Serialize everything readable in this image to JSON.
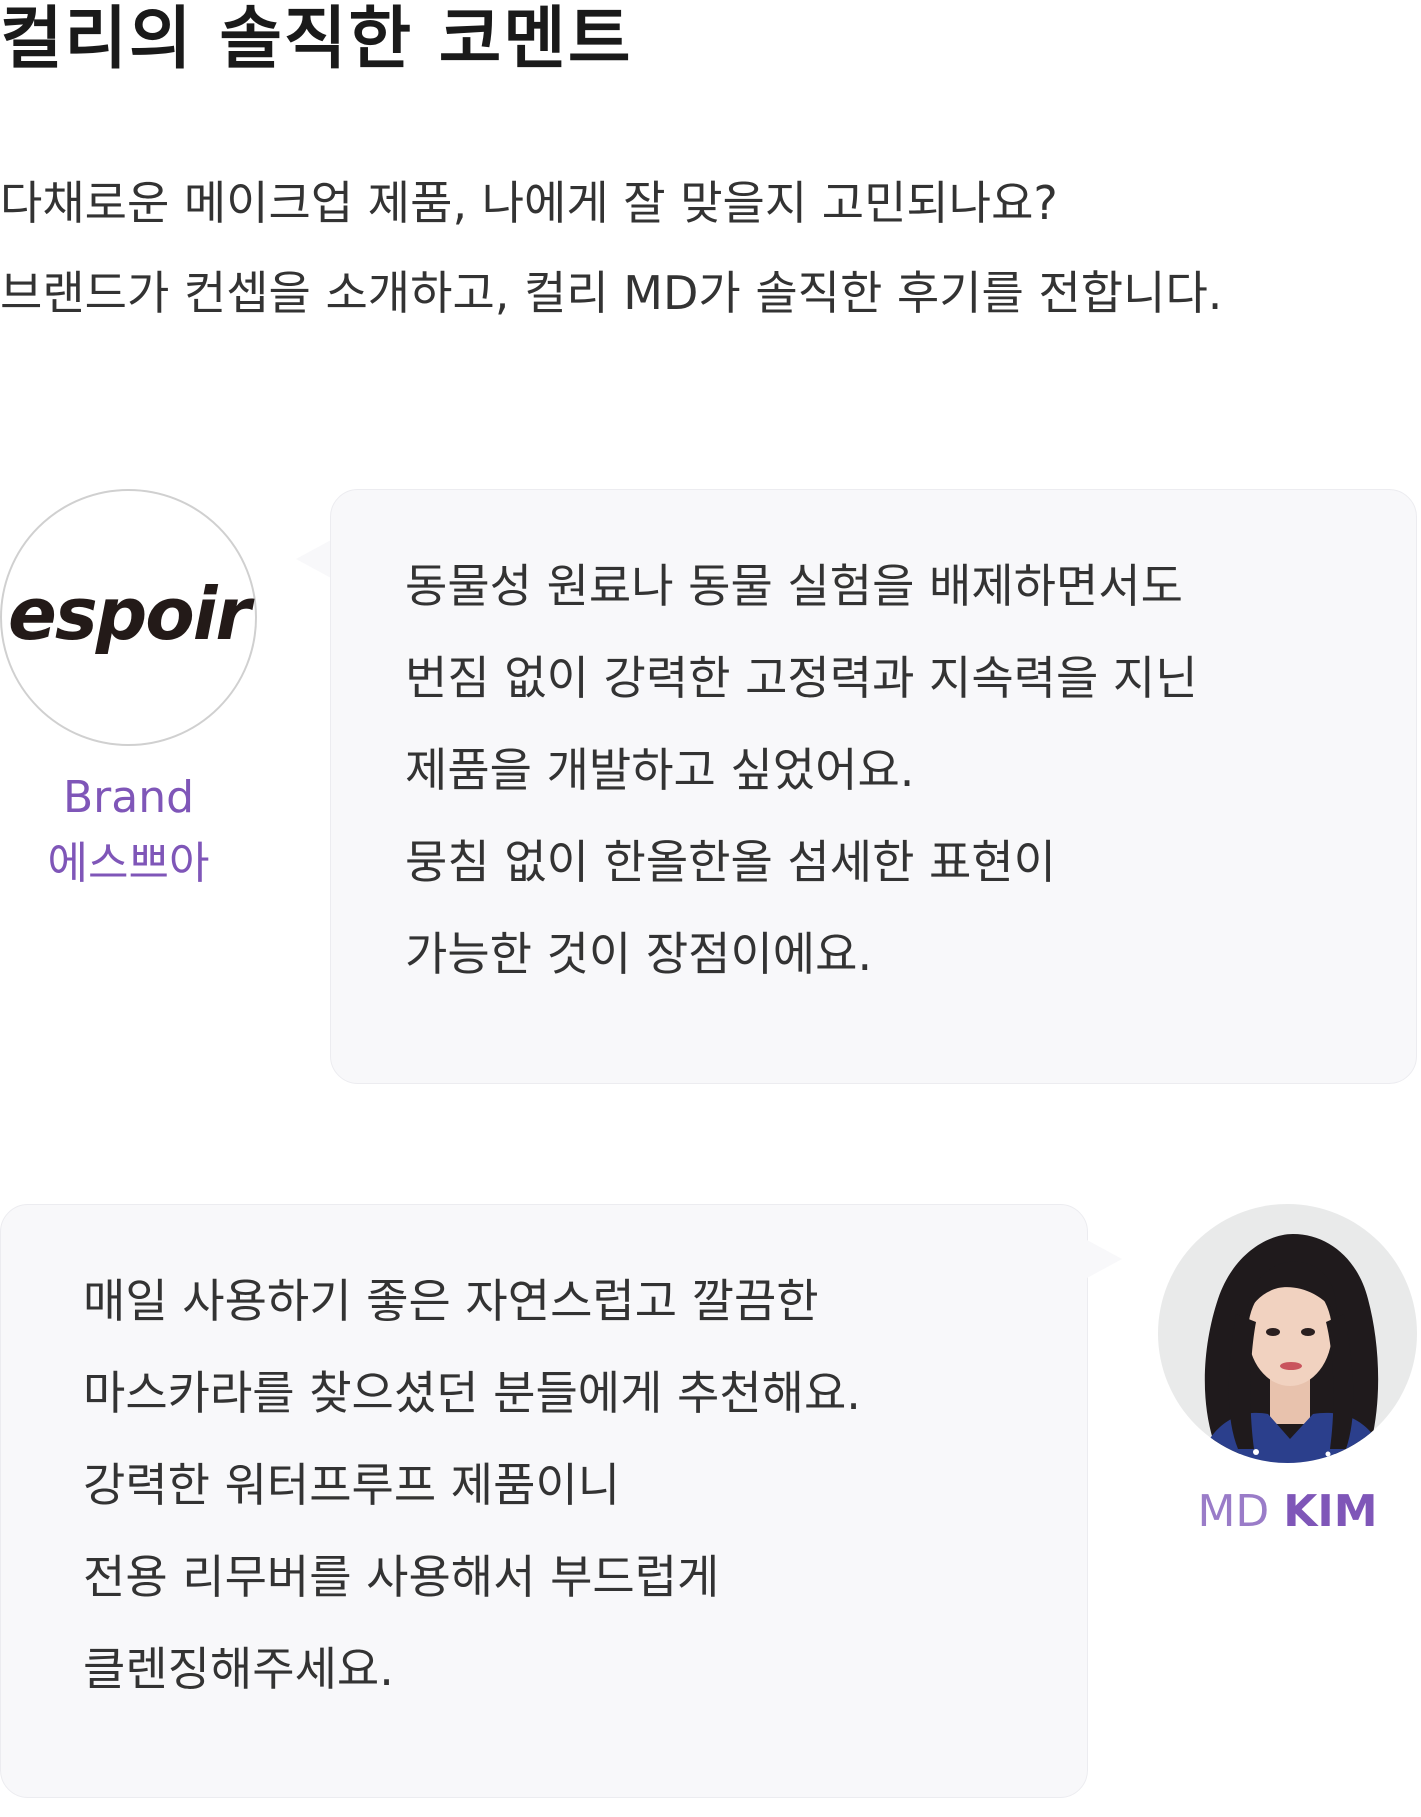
{
  "header": {
    "title": "컬리의 솔직한 코멘트",
    "intro_lines": [
      "다채로운 메이크업 제품, 나에게 잘 맞을지 고민되나요?",
      "브랜드가 컨셉을 소개하고, 컬리 MD가 솔직한 후기를 전합니다."
    ]
  },
  "brand_comment": {
    "logo_text": "espoir",
    "role": "Brand",
    "name": "에스쁘아",
    "lines": [
      "동물성 원료나 동물 실험을 배제하면서도",
      "번짐 없이 강력한 고정력과 지속력을 지닌",
      "제품을 개발하고 싶었어요.",
      "뭉침 없이 한올한올 섬세한 표현이",
      "가능한 것이 장점이에요."
    ]
  },
  "md_comment": {
    "role": "MD",
    "surname": "KIM",
    "lines": [
      "매일 사용하기 좋은 자연스럽고 깔끔한",
      "마스카라를 찾으셨던 분들에게 추천해요.",
      "강력한 워터프루프 제품이니",
      "전용 리무버를 사용해서 부드럽게",
      "클렌징해주세요."
    ]
  },
  "colors": {
    "accent_purple": "#7f56b8",
    "bubble_background": "#f8f8fa",
    "text": "#333333"
  }
}
